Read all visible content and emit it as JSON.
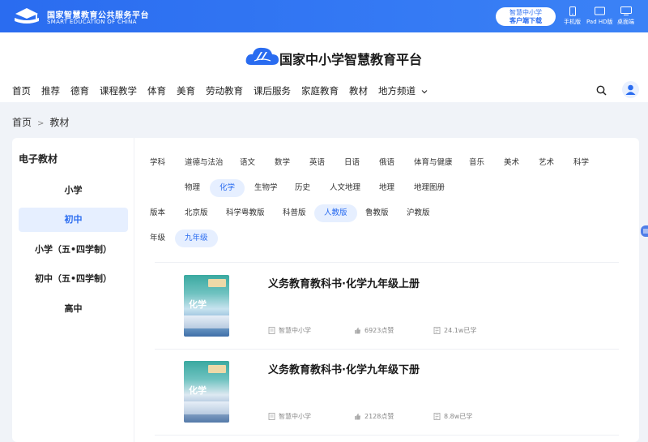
{
  "topbar": {
    "brand_cn": "国家智慧教育公共服务平台",
    "brand_en": "SMART EDUCATION OF CHINA",
    "download_line1": "智慧中小学",
    "download_line2": "客户端下载",
    "devices": [
      {
        "label": "手机版",
        "icon": "phone-icon"
      },
      {
        "label": "Pad HD版",
        "icon": "tablet-icon"
      },
      {
        "label": "桌面端",
        "icon": "desktop-icon"
      }
    ]
  },
  "header": {
    "site_title": "国家中小学智慧教育平台",
    "nav": [
      "首页",
      "推荐",
      "德育",
      "课程教学",
      "体育",
      "美育",
      "劳动教育",
      "课后服务",
      "家庭教育",
      "教材",
      "地方频道"
    ]
  },
  "breadcrumb": {
    "home": "首页",
    "sep": ">",
    "current": "教材"
  },
  "sidebar": {
    "title": "电子教材",
    "items": [
      "小学",
      "初中",
      "小学（五•四学制）",
      "初中（五•四学制）",
      "高中"
    ],
    "active_index": 1
  },
  "filters": {
    "subjects": [
      "学科",
      "道德与法治",
      "语文",
      "数学",
      "英语",
      "日语",
      "俄语",
      "体育与健康",
      "音乐",
      "美术",
      "艺术",
      "科学"
    ],
    "subjects2": [
      "物理",
      "化学",
      "生物学",
      "历史",
      "人文地理",
      "地理",
      "地理图册"
    ],
    "subject_active": "化学",
    "version_label": "版本",
    "versions": [
      "北京版",
      "科学粤教版",
      "科普版",
      "人教版",
      "鲁教版",
      "沪教版"
    ],
    "version_active": "人教版",
    "grade_label": "年级",
    "grades": [
      "九年级"
    ],
    "grade_active": "九年级"
  },
  "books": [
    {
      "title": "义务教育教科书·化学九年级上册",
      "publisher": "智慧中小学",
      "likes": "6923点赞",
      "learned": "24.1w已学",
      "cover_text": "化学"
    },
    {
      "title": "义务教育教科书·化学九年级下册",
      "publisher": "智慧中小学",
      "likes": "2128点赞",
      "learned": "8.8w已学",
      "cover_text": "化学"
    }
  ],
  "colors": {
    "primary": "#2a6cf0",
    "active_bg": "#e6efff"
  }
}
